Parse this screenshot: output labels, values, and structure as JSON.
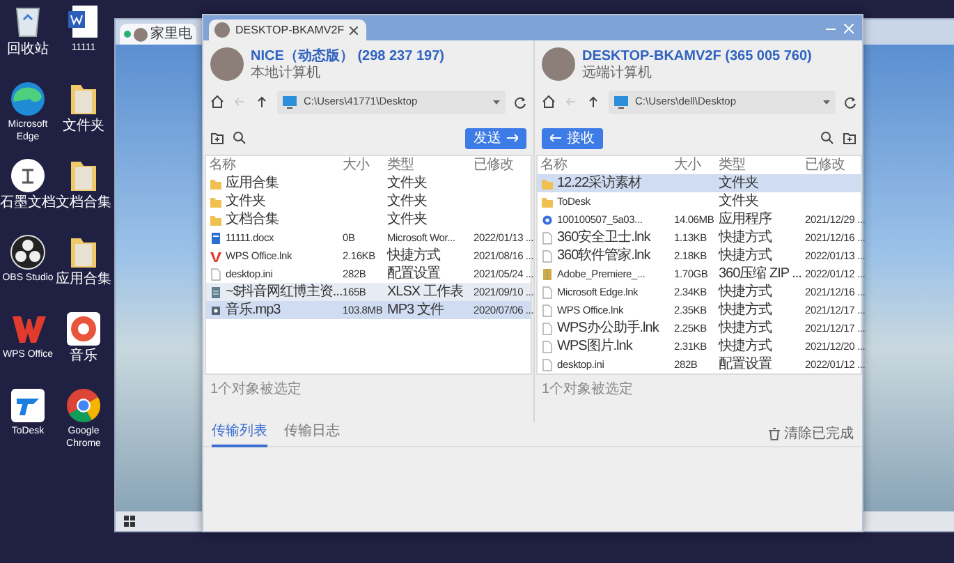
{
  "desktop_icons": [
    {
      "label": "回收站",
      "kind": "recycle"
    },
    {
      "label": "11111",
      "kind": "word"
    },
    {
      "label": "Microsoft Edge",
      "kind": "edge"
    },
    {
      "label": "文件夹",
      "kind": "folder"
    },
    {
      "label": "石墨文档",
      "kind": "shimo"
    },
    {
      "label": "文档合集",
      "kind": "folder"
    },
    {
      "label": "OBS Studio",
      "kind": "obs"
    },
    {
      "label": "应用合集",
      "kind": "folder"
    },
    {
      "label": "WPS Office",
      "kind": "wps"
    },
    {
      "label": "音乐",
      "kind": "music"
    },
    {
      "label": "ToDesk",
      "kind": "todesk"
    },
    {
      "label": "Google Chrome",
      "kind": "chrome"
    }
  ],
  "remote_window": {
    "tab": "家里电"
  },
  "transfer_window": {
    "tab": "DESKTOP-BKAMV2F",
    "panels": [
      {
        "name": "NICE（动态版）",
        "id": "(298 237 197)",
        "role": "本地计算机",
        "path": "C:\\Users\\41771\\Desktop",
        "action": {
          "label": "发送",
          "kind": "send"
        },
        "columns": [
          "名称",
          "大小",
          "类型",
          "已修改"
        ],
        "rows": [
          {
            "kind": "folder",
            "name": "应用合集",
            "type": "文件夹",
            "selected": false,
            "hovered": false
          },
          {
            "kind": "folder",
            "name": "文件夹",
            "type": "文件夹",
            "selected": false,
            "hovered": false
          },
          {
            "kind": "folder",
            "name": "文档合集",
            "type": "文件夹",
            "selected": false,
            "hovered": false
          },
          {
            "kind": "word",
            "name": "11111.docx",
            "size": "0B",
            "type": "Microsoft Wor...",
            "modified": "2022/01/13 ...",
            "selected": false,
            "hovered": false
          },
          {
            "kind": "wps",
            "name": "WPS Office.lnk",
            "size": "2.16KB",
            "type": "快捷方式",
            "modified": "2021/08/16 ...",
            "selected": false,
            "hovered": false
          },
          {
            "kind": "file",
            "name": "desktop.ini",
            "size": "282B",
            "type": "配置设置",
            "modified": "2021/05/24 ...",
            "selected": false,
            "hovered": false
          },
          {
            "kind": "sheet",
            "name": "~$抖音网红博主资...",
            "size": "165B",
            "type": "XLSX 工作表",
            "modified": "2021/09/10 ...",
            "selected": false,
            "hovered": true
          },
          {
            "kind": "audio",
            "name": "音乐.mp3",
            "size": "103.8MB",
            "type": "MP3 文件",
            "modified": "2020/07/06 ...",
            "selected": true,
            "hovered": false
          }
        ],
        "status": "1个对象被选定"
      },
      {
        "name": "DESKTOP-BKAMV2F",
        "id": "(365 005 760)",
        "role": "远端计算机",
        "path": "C:\\Users\\dell\\Desktop",
        "action": {
          "label": "接收",
          "kind": "receive"
        },
        "columns": [
          "名称",
          "大小",
          "类型",
          "已修改"
        ],
        "rows": [
          {
            "kind": "folder",
            "name": "12.22采访素材",
            "type": "文件夹",
            "selected": true,
            "hovered": false
          },
          {
            "kind": "folder",
            "name": "ToDesk",
            "type": "文件夹",
            "selected": false,
            "hovered": false
          },
          {
            "kind": "app",
            "name": "100100507_5a03...",
            "size": "14.06MB",
            "type": "应用程序",
            "modified": "2021/12/29 ...",
            "selected": false,
            "hovered": false
          },
          {
            "kind": "file",
            "name": "360安全卫士.lnk",
            "size": "1.13KB",
            "type": "快捷方式",
            "modified": "2021/12/16 ...",
            "selected": false,
            "hovered": false
          },
          {
            "kind": "file",
            "name": "360软件管家.lnk",
            "size": "2.18KB",
            "type": "快捷方式",
            "modified": "2022/01/13 ...",
            "selected": false,
            "hovered": false
          },
          {
            "kind": "archive",
            "name": "Adobe_Premiere_...",
            "size": "1.70GB",
            "type": "360压缩 ZIP ...",
            "modified": "2022/01/12 ...",
            "selected": false,
            "hovered": false
          },
          {
            "kind": "file",
            "name": "Microsoft Edge.lnk",
            "size": "2.34KB",
            "type": "快捷方式",
            "modified": "2021/12/16 ...",
            "selected": false,
            "hovered": false
          },
          {
            "kind": "file",
            "name": "WPS Office.lnk",
            "size": "2.35KB",
            "type": "快捷方式",
            "modified": "2021/12/17 ...",
            "selected": false,
            "hovered": false
          },
          {
            "kind": "file",
            "name": "WPS办公助手.lnk",
            "size": "2.25KB",
            "type": "快捷方式",
            "modified": "2021/12/17 ...",
            "selected": false,
            "hovered": false
          },
          {
            "kind": "file",
            "name": "WPS图片.lnk",
            "size": "2.31KB",
            "type": "快捷方式",
            "modified": "2021/12/20 ...",
            "selected": false,
            "hovered": false
          },
          {
            "kind": "file",
            "name": "desktop.ini",
            "size": "282B",
            "type": "配置设置",
            "modified": "2022/01/12 ...",
            "selected": false,
            "hovered": false
          }
        ],
        "status": "1个对象被选定"
      }
    ],
    "transfer_tabs": [
      {
        "label": "传输列表",
        "selected": true
      },
      {
        "label": "传输日志",
        "selected": false
      }
    ],
    "clear_button": "清除已完成"
  }
}
